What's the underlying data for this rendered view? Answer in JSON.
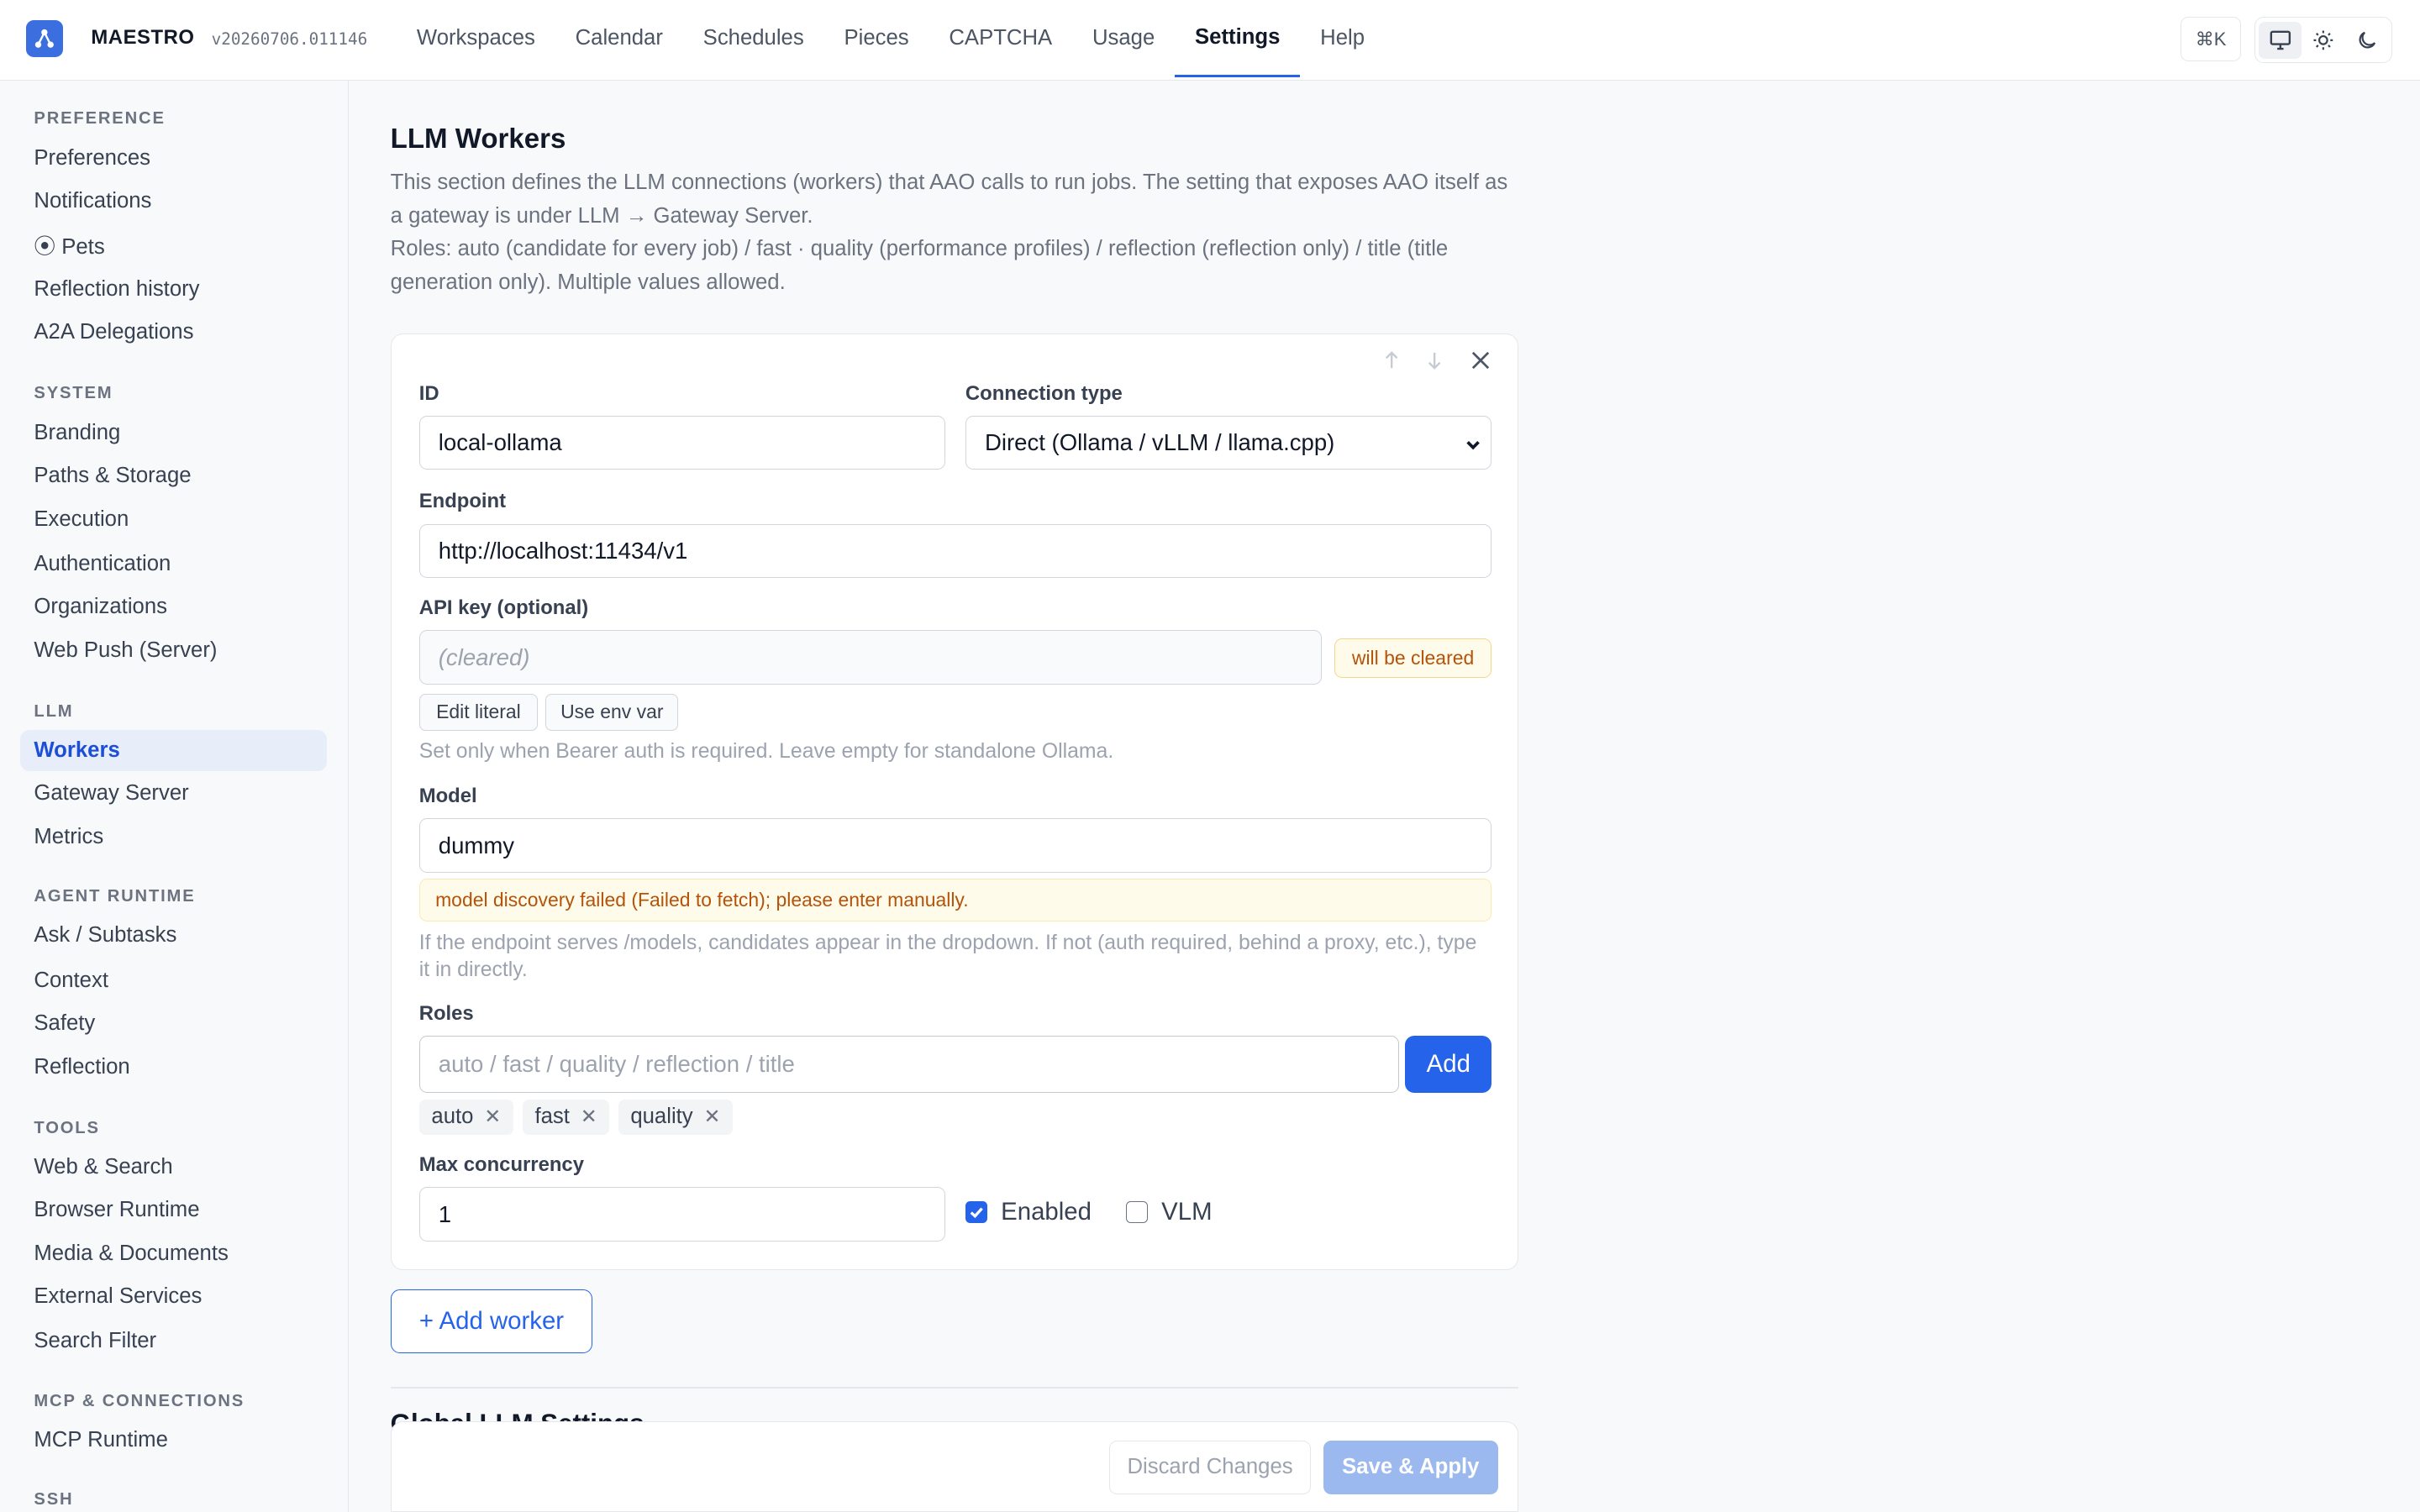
{
  "app": {
    "name": "MAESTRO",
    "version": "v20260706.011146",
    "logo_icon": "logo-icon"
  },
  "nav": [
    {
      "label": "Workspaces",
      "active": false
    },
    {
      "label": "Calendar",
      "active": false
    },
    {
      "label": "Schedules",
      "active": false
    },
    {
      "label": "Pieces",
      "active": false
    },
    {
      "label": "CAPTCHA",
      "active": false
    },
    {
      "label": "Usage",
      "active": false
    },
    {
      "label": "Settings",
      "active": true
    },
    {
      "label": "Help",
      "active": false
    }
  ],
  "toolbar": {
    "cmdk_label": "⌘K",
    "theme_icons": [
      "monitor-icon",
      "sun-icon",
      "moon-icon"
    ],
    "active_theme": "monitor-icon"
  },
  "sidebar": {
    "groups": [
      {
        "title": "PREFERENCE",
        "items": [
          "Preferences",
          " Notifications",
          "⦿ Pets",
          " Reflection history",
          " A2A Delegations"
        ]
      },
      {
        "title": "SYSTEM",
        "items": [
          "Branding",
          "Paths & Storage",
          "Execution",
          "Authentication",
          " Organizations",
          "Web Push (Server)"
        ]
      },
      {
        "title": "LLM",
        "items": [
          "Workers",
          "Gateway Server",
          "Metrics"
        ]
      },
      {
        "title": "AGENT RUNTIME",
        "items": [
          "Ask / Subtasks",
          "Context",
          "Safety",
          "Reflection"
        ]
      },
      {
        "title": "TOOLS",
        "items": [
          "Web & Search",
          "Browser Runtime",
          "Media & Documents",
          "External Services",
          "Search Filter"
        ]
      },
      {
        "title": "MCP & CONNECTIONS",
        "items": [
          "MCP Runtime"
        ]
      },
      {
        "title": "SSH",
        "items": []
      }
    ],
    "active_item": "Workers"
  },
  "page": {
    "title": "LLM Workers",
    "description_1": "This section defines the LLM connections (workers) that AAO calls to run jobs. The setting that exposes AAO itself as a gateway is under LLM → Gateway Server.",
    "description_2": "Roles: auto (candidate for every job) / fast · quality (performance profiles) / reflection (reflection only) / title (title generation only). Multiple values allowed."
  },
  "worker": {
    "id_label": "ID",
    "id_value": "local-ollama",
    "conn_label": "Connection type",
    "conn_value": "Direct (Ollama / vLLM / llama.cpp)",
    "endpoint_label": "Endpoint",
    "endpoint_value": "http://localhost:11434/v1",
    "apikey_label": "API key (optional)",
    "apikey_placeholder": "(cleared)",
    "apikey_badge": "will be cleared",
    "edit_literal": "Edit literal",
    "use_env_var": "Use env var",
    "apikey_hint": "Set only when Bearer auth is required. Leave empty for standalone Ollama.",
    "model_label": "Model",
    "model_value": "dummy",
    "model_warning": "model discovery failed (Failed to fetch); please enter manually.",
    "model_hint": "If the endpoint serves /models, candidates appear in the dropdown. If not (auth required, behind a proxy, etc.), type it in directly.",
    "roles_label": "Roles",
    "roles_placeholder": "auto / fast / quality / reflection / title",
    "roles_add": "Add",
    "roles": [
      "auto",
      "fast",
      "quality"
    ],
    "maxc_label": "Max concurrency",
    "maxc_value": "1",
    "enabled_label": "Enabled",
    "enabled": true,
    "vlm_label": "VLM",
    "vlm": false
  },
  "actions": {
    "add_worker": "+ Add worker",
    "section2_title": "Global LLM Settings",
    "discard": "Discard Changes",
    "save": "Save & Apply"
  }
}
